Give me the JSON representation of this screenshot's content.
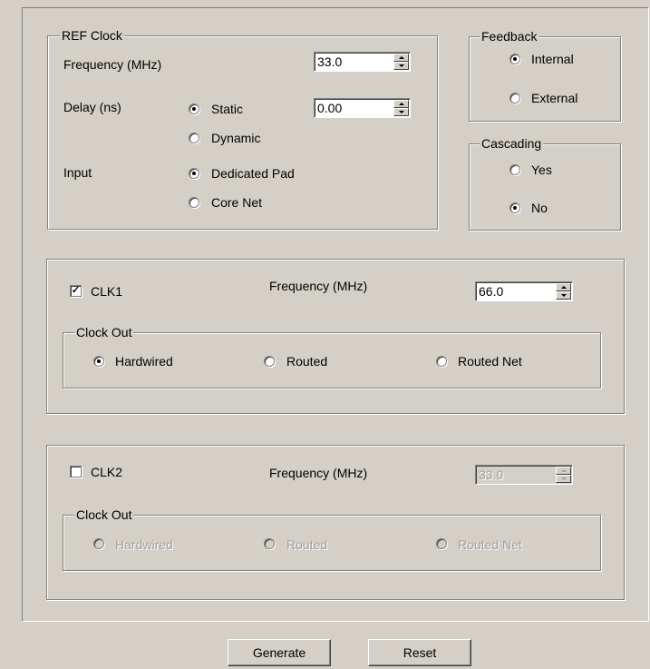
{
  "ref_clock": {
    "title": "REF Clock",
    "frequency_label": "Frequency (MHz)",
    "frequency_value": "33.0",
    "delay_label": "Delay (ns)",
    "delay_value": "0.00",
    "delay_options": [
      {
        "label": "Static",
        "selected": true
      },
      {
        "label": "Dynamic",
        "selected": false
      }
    ],
    "input_label": "Input",
    "input_options": [
      {
        "label": "Dedicated Pad",
        "selected": true
      },
      {
        "label": "Core Net",
        "selected": false
      }
    ]
  },
  "feedback": {
    "title": "Feedback",
    "options": [
      {
        "label": "Internal",
        "selected": true
      },
      {
        "label": "External",
        "selected": false
      }
    ]
  },
  "cascading": {
    "title": "Cascading",
    "options": [
      {
        "label": "Yes",
        "selected": false
      },
      {
        "label": "No",
        "selected": true
      }
    ]
  },
  "clk1": {
    "label": "CLK1",
    "checked": true,
    "frequency_label": "Frequency (MHz)",
    "frequency_value": "66.0",
    "clock_out_title": "Clock Out",
    "clock_out_options": [
      {
        "label": "Hardwired",
        "selected": true
      },
      {
        "label": "Routed",
        "selected": false
      },
      {
        "label": "Routed Net",
        "selected": false
      }
    ]
  },
  "clk2": {
    "label": "CLK2",
    "checked": false,
    "frequency_label": "Frequency (MHz)",
    "frequency_value": "33.0",
    "clock_out_title": "Clock Out",
    "clock_out_options": [
      {
        "label": "Hardwired",
        "selected": false
      },
      {
        "label": "Routed",
        "selected": false
      },
      {
        "label": "Routed Net",
        "selected": false
      }
    ]
  },
  "buttons": {
    "generate_label": "Generate",
    "reset_label": "Reset"
  },
  "check_mark": "✓"
}
